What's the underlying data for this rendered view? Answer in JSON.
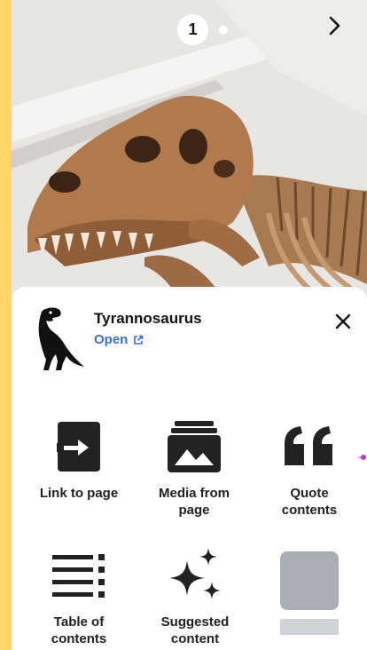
{
  "hero": {
    "page_number": "1",
    "next_icon": "chevron-right-icon"
  },
  "sheet": {
    "title": "Tyrannosaurus",
    "open_label": "Open",
    "open_icon": "external-link-icon",
    "close_icon": "close-icon"
  },
  "actions": [
    {
      "label_line1": "Link to page",
      "label_line2": "",
      "icon": "link-to-page-icon"
    },
    {
      "label_line1": "Media from",
      "label_line2": "page",
      "icon": "media-icon"
    },
    {
      "label_line1": "Quote",
      "label_line2": "contents",
      "icon": "quote-icon"
    },
    {
      "label_line1": "Table of",
      "label_line2": "contents",
      "icon": "table-of-contents-icon"
    },
    {
      "label_line1": "Suggested",
      "label_line2": "content",
      "icon": "sparkles-icon"
    },
    {
      "label_line1": "",
      "label_line2": "",
      "icon": "placeholder-tile"
    }
  ],
  "colors": {
    "accent": "#3a6fd8",
    "border": "#ffd469",
    "placeholder": "#a9adb4"
  }
}
